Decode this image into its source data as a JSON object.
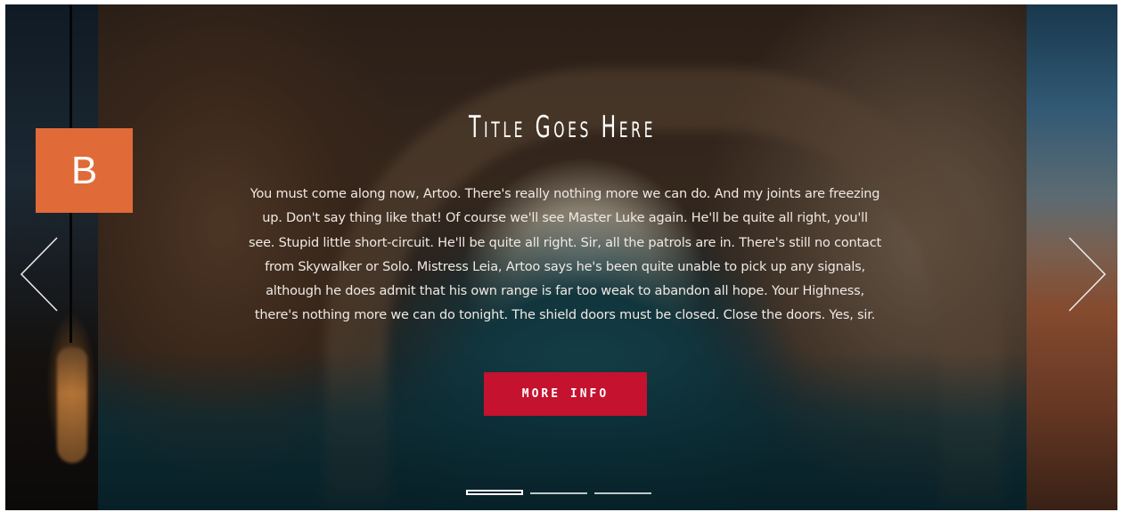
{
  "badge": {
    "label": "B"
  },
  "slider": {
    "title": "Title Goes Here",
    "body": "You must come along now, Artoo. There's really nothing more we can do. And my joints are freezing up. Don't say thing like that! Of course we'll see Master Luke again. He'll be quite all right, you'll see. Stupid little short-circuit. He'll be quite all right. Sir, all the patrols are in. There's still no contact from Skywalker or Solo. Mistress Leia, Artoo says he's been quite unable to pick up any signals, although he does admit that his own range is far too weak to abandon all hope. Your Highness, there's nothing more we can do tonight. The shield doors must be closed. Close the doors. Yes, sir.",
    "button_label": "MORE INFO",
    "button_color": "#c4122f",
    "prev_icon": "chevron-left-icon",
    "next_icon": "chevron-right-icon",
    "slide_count": 3,
    "active_slide": 1
  },
  "colors": {
    "badge": "#e06a38",
    "text": "#ffffff"
  }
}
